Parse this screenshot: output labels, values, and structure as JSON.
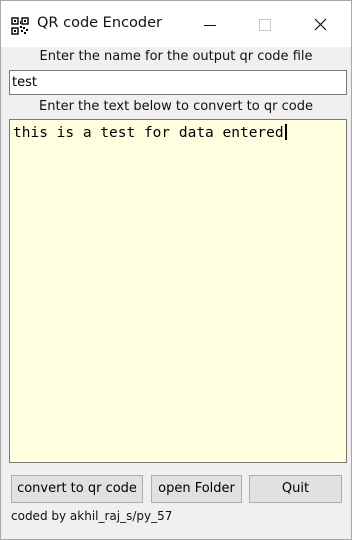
{
  "window": {
    "title": "QR code Encoder",
    "icons": [
      "qr-icon",
      "minimize-icon",
      "maximize-icon",
      "close-icon"
    ]
  },
  "form": {
    "name_label": "Enter the name for the output qr code file",
    "name_value": "test",
    "text_label": "Enter the text below to convert to qr code",
    "text_value": "this is a test for data entered"
  },
  "buttons": {
    "convert": "convert to qr code",
    "open_folder": "open Folder",
    "quit": "Quit"
  },
  "footer": {
    "credits": "coded by akhil_raj_s/py_57"
  },
  "colors": {
    "text_area_bg": "#ffffe0",
    "window_bg": "#f0f0f0"
  }
}
